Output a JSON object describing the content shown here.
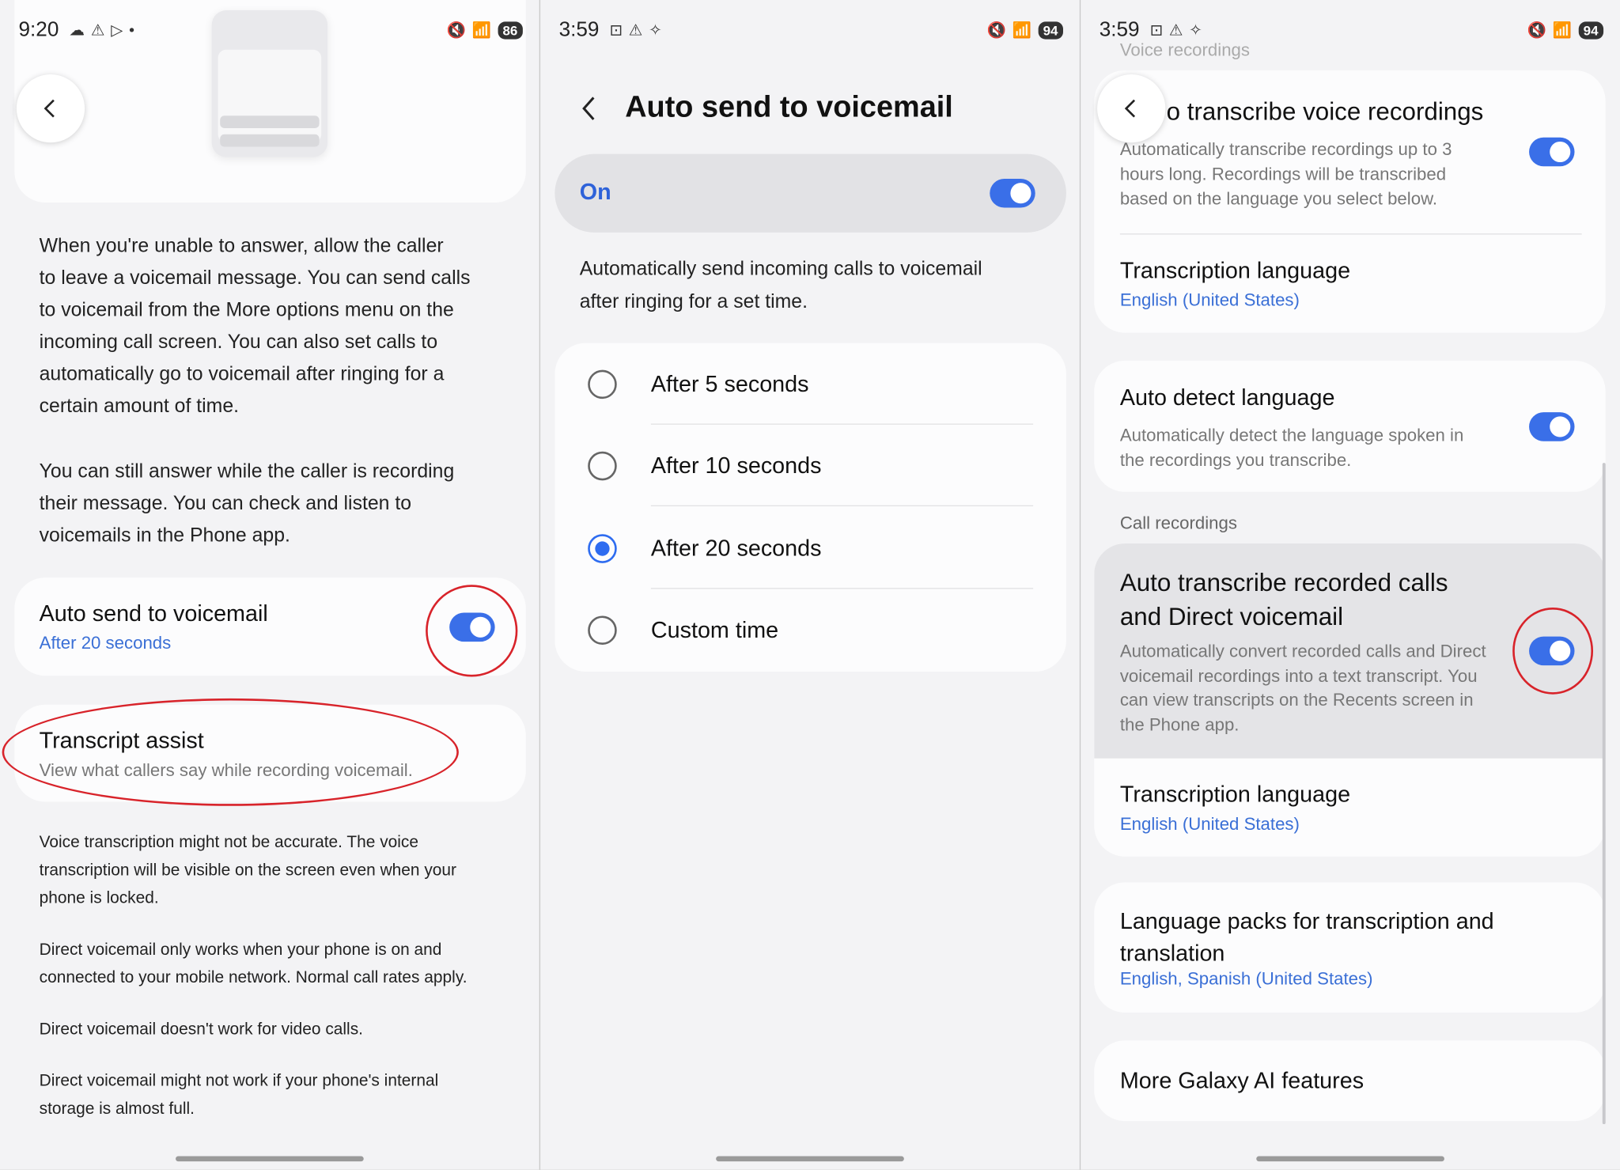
{
  "panel1": {
    "status": {
      "time": "9:20",
      "battery": "86"
    },
    "description_1": [
      "When you're unable to answer, allow the caller",
      "to leave a voicemail message. You can send calls",
      "to voicemail from the More options menu on the",
      "incoming call screen. You can also set calls to",
      "automatically go to voicemail after ringing for a",
      "certain amount of time."
    ],
    "description_2": [
      "You can still answer while the caller is recording",
      "their message. You can check and listen to",
      "voicemails in the Phone app."
    ],
    "auto_send": {
      "title": "Auto send to voicemail",
      "subtitle": "After 20 seconds",
      "enabled": true
    },
    "transcript": {
      "title": "Transcript assist",
      "subtitle": "View what callers say while recording voicemail."
    },
    "notes": [
      [
        "Voice transcription might not be accurate. The voice",
        "transcription will be visible on the screen even when your",
        "phone is locked."
      ],
      [
        "Direct voicemail only works when your phone is on and",
        "connected to your mobile network. Normal call rates apply."
      ],
      [
        "Direct voicemail doesn't work for video calls."
      ],
      [
        "Direct voicemail might not work if your phone's internal",
        "storage is almost full."
      ]
    ]
  },
  "panel2": {
    "status": {
      "time": "3:59",
      "battery": "94"
    },
    "title": "Auto send to voicemail",
    "master": {
      "label": "On",
      "enabled": true
    },
    "description": [
      "Automatically send incoming calls to voicemail",
      "after ringing for a set time."
    ],
    "options": [
      {
        "label": "After 5 seconds",
        "selected": false
      },
      {
        "label": "After 10 seconds",
        "selected": false
      },
      {
        "label": "After 20 seconds",
        "selected": true
      },
      {
        "label": "Custom time",
        "selected": false
      }
    ]
  },
  "panel3": {
    "status": {
      "time": "3:59",
      "battery": "94"
    },
    "section_voice": "Voice recordings",
    "auto_voice": {
      "title": "o transcribe voice recordings",
      "desc": [
        "Automatically transcribe recordings up to 3",
        "hours long. Recordings will be transcribed",
        "based on the language you select below."
      ],
      "enabled": true
    },
    "lang1": {
      "title": "Transcription language",
      "value": "English (United States)"
    },
    "auto_detect": {
      "title": "Auto detect language",
      "desc": [
        "Automatically detect the language spoken in",
        "the recordings you transcribe."
      ],
      "enabled": true
    },
    "section_calls": "Call recordings",
    "auto_calls": {
      "title": [
        "Auto transcribe recorded calls",
        "and Direct voicemail"
      ],
      "desc": [
        "Automatically convert recorded calls and Direct",
        "voicemail recordings into a text transcript. You",
        "can view transcripts on the Recents screen in",
        "the Phone app."
      ],
      "enabled": true
    },
    "lang2": {
      "title": "Transcription language",
      "value": "English (United States)"
    },
    "packs": {
      "title": [
        "Language packs for transcription and",
        "translation"
      ],
      "value": "English, Spanish (United States)"
    },
    "more": "More Galaxy AI features"
  },
  "colors": {
    "accent": "#3a6fe8",
    "link": "#3a6fd6",
    "highlight_ring": "#d8232a",
    "panel_bg": "#f3f3f5"
  }
}
